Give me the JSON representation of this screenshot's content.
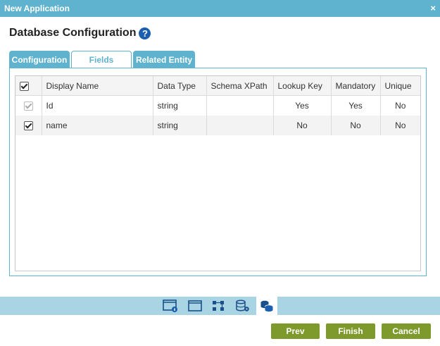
{
  "window": {
    "title": "New Application",
    "close_label": "×"
  },
  "page": {
    "heading": "Database Configuration",
    "help": "?"
  },
  "tabs": [
    {
      "label": "Configuration",
      "active": false
    },
    {
      "label": "Fields",
      "active": true
    },
    {
      "label": "Related Entity",
      "active": false
    }
  ],
  "grid": {
    "columns": [
      "Display Name",
      "Data Type",
      "Schema XPath",
      "Lookup Key",
      "Mandatory",
      "Unique"
    ],
    "rows": [
      {
        "checked": true,
        "disabled": true,
        "display_name": "Id",
        "data_type": "string",
        "schema_xpath": "",
        "lookup_key": "Yes",
        "mandatory": "Yes",
        "unique": "No"
      },
      {
        "checked": true,
        "disabled": false,
        "display_name": "name",
        "data_type": "string",
        "schema_xpath": "",
        "lookup_key": "No",
        "mandatory": "No",
        "unique": "No"
      }
    ]
  },
  "toolbar": {
    "icons": [
      "app-info-icon",
      "form-icon",
      "process-icon",
      "data-settings-icon",
      "database-icon"
    ],
    "selected": "database-icon"
  },
  "buttons": {
    "prev": "Prev",
    "finish": "Finish",
    "cancel": "Cancel"
  },
  "colors": {
    "accent": "#5fb3cf",
    "toolbar_bg": "#a9d4e3",
    "button": "#7f9a2c",
    "help": "#1b5fae"
  }
}
